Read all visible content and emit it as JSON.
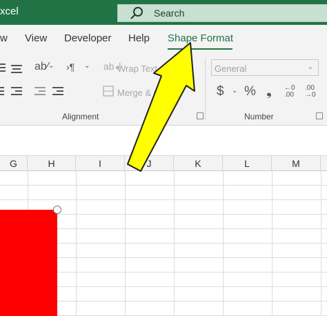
{
  "titlebar": {
    "app_title": "xcel",
    "search_label": "Search"
  },
  "tabs": [
    {
      "label": "w"
    },
    {
      "label": "View"
    },
    {
      "label": "Developer"
    },
    {
      "label": "Help"
    },
    {
      "label": "Shape Format",
      "active": true
    }
  ],
  "ribbon": {
    "alignment": {
      "label": "Alignment",
      "wrap_text": "Wrap Text",
      "merge_center": "Merge & Center"
    },
    "number": {
      "label": "Number",
      "format_value": "General",
      "currency_symbol": "$",
      "percent_symbol": "%",
      "comma_symbol": "❟",
      "increase_decimal": "←0 .00",
      "decrease_decimal": ".00 →0"
    }
  },
  "columns": [
    "G",
    "H",
    "I",
    "J",
    "K",
    "L",
    "M"
  ],
  "colors": {
    "excel_green": "#217346",
    "annotation_arrow": "#ffff00",
    "shape_fill": "#ff0000"
  }
}
